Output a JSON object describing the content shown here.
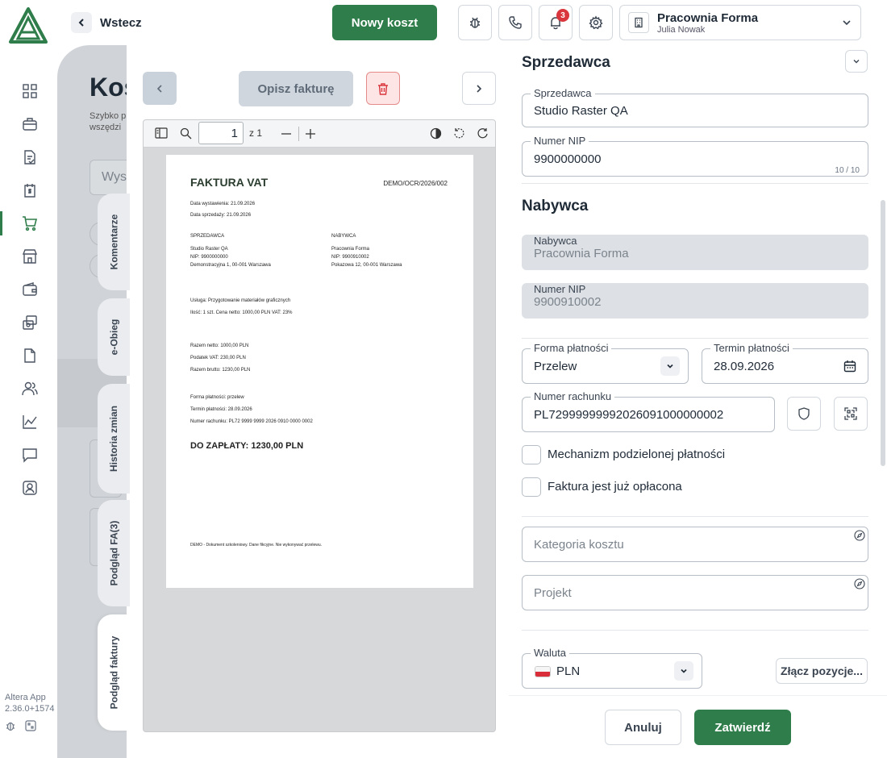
{
  "topbar": {
    "back_label": "Wstecz",
    "new_cost_label": "Nowy koszt",
    "notification_count": "3",
    "company_name": "Pracownia Forma",
    "user_name": "Julia Nowak"
  },
  "sidebar": {
    "icons": [
      "dashboard-icon",
      "briefcase-icon",
      "document-check-icon",
      "money-document-icon",
      "cart-icon",
      "store-icon",
      "wallet-icon",
      "transfer-icon",
      "file-icon",
      "users-icon",
      "chart-icon",
      "message-icon",
      "contact-icon"
    ],
    "active_index": 4,
    "version_line1": "Altera App",
    "version_line2": "2.36.0+1574"
  },
  "background": {
    "title": "Kos",
    "subtitle_line1": "Szybko p",
    "subtitle_line2": "wszędzi",
    "search_placeholder": "Wysz"
  },
  "tabs": [
    {
      "label": "Komentarze"
    },
    {
      "label": "e-Obieg"
    },
    {
      "label": "Historia zmian"
    },
    {
      "label": "Podgląd FA(3)"
    },
    {
      "label": "Podgląd faktury"
    }
  ],
  "preview": {
    "describe_label": "Opisz fakturę",
    "page_current": "1",
    "page_of": "z 1",
    "doc": {
      "title": "FAKTURA VAT",
      "number": "DEMO/OCR/2026/002",
      "issue_date": "Data wystawienia: 21.09.2026",
      "sale_date": "Data sprzedaży: 21.09.2026",
      "seller_head": "SPRZEDAWCA",
      "seller_name": "Studio Raster QA",
      "seller_nip": "NIP: 9900000000",
      "seller_addr": "Demonstracyjna 1, 00-001 Warszawa",
      "buyer_head": "NABYWCA",
      "buyer_name": "Pracownia Forma",
      "buyer_nip": "NIP: 9900910002",
      "buyer_addr": "Pokazowa 12, 00-001 Warszawa",
      "service": "Usługa: Przygotowanie materiałów graficznych",
      "qty_line": "Ilość: 1 szt.    Cena netto: 1000,00 PLN    VAT: 23%",
      "net": "Razem netto: 1000,00 PLN",
      "vat": "Podatek VAT: 230,00 PLN",
      "gross": "Razem brutto: 1230,00 PLN",
      "pay_form": "Forma płatności: przelew",
      "pay_term": "Termin płatności: 28.09.2026",
      "account": "Numer rachunku: PL72 9999 9999 2026 0910 0000 0002",
      "to_pay": "DO ZAPŁATY: 1230,00 PLN",
      "footer": "DEMO - Dokument szkoleniowy. Dane fikcyjne. Nie wykonywać przelewu."
    }
  },
  "form": {
    "seller_section": "Sprzedawca",
    "seller_label": "Sprzedawca",
    "seller_value": "Studio Raster QA",
    "seller_nip_label": "Numer NIP",
    "seller_nip_value": "9900000000",
    "seller_nip_counter": "10 / 10",
    "buyer_section": "Nabywca",
    "buyer_label": "Nabywca",
    "buyer_value": "Pracownia Forma",
    "buyer_nip_label": "Numer NIP",
    "buyer_nip_value": "9900910002",
    "payment_form_label": "Forma płatności",
    "payment_form_value": "Przelew",
    "payment_term_label": "Termin płatności",
    "payment_term_value": "28.09.2026",
    "account_label": "Numer rachunku",
    "account_value": "PL72999999992026091000000002",
    "split_payment_label": "Mechanizm podzielonej płatności",
    "paid_label": "Faktura jest już opłacona",
    "category_placeholder": "Kategoria kosztu",
    "project_placeholder": "Projekt",
    "currency_label": "Waluta",
    "currency_value": "PLN",
    "merge_label": "Złącz pozycje..."
  },
  "footer": {
    "cancel_label": "Anuluj",
    "confirm_label": "Zatwierdź"
  },
  "colors": {
    "primary": "#2f7d4a",
    "danger": "#d9363e"
  }
}
